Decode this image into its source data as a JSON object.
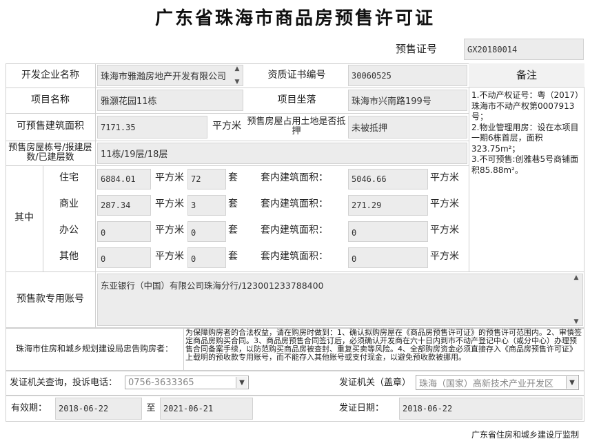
{
  "title": "广东省珠海市商品房预售许可证",
  "permit": {
    "label": "预售证号",
    "value": "GX20180014"
  },
  "developer": {
    "label": "开发企业名称",
    "value": "珠海市雅瀚房地产开发有限公司"
  },
  "cert": {
    "label": "资质证书编号",
    "value": "30060525"
  },
  "remarks_header": "备注",
  "remarks": [
    "1.不动产权证号：粤（2017）珠海市不动产权第0007913号；",
    "2.物业管理用房：设在本项目一期6栋首层，面积323.75m²；",
    "3.不可预售:创雅巷5号商铺面积85.88m²。"
  ],
  "project": {
    "label": "项目名称",
    "value": "雅灏花园11栋",
    "loc_label": "项目坐落",
    "loc_value": "珠海市兴南路199号"
  },
  "area": {
    "label": "可预售建筑面积",
    "value": "7171.35",
    "unit": "平方米",
    "land_label": "预售房屋占用土地是否抵押",
    "land_value": "未被抵押"
  },
  "building": {
    "label": "预售房屋栋号/报建层数/已建层数",
    "value": "11栋/19层/18层"
  },
  "breakdown": {
    "label": "其中",
    "unit_area": "平方米",
    "unit_count": "套",
    "inner_label": "套内建筑面积：",
    "rows": [
      {
        "type": "住宅",
        "area": "6884.01",
        "count": "72",
        "inner": "5046.66"
      },
      {
        "type": "商业",
        "area": "287.34",
        "count": "3",
        "inner": "271.29"
      },
      {
        "type": "办公",
        "area": "0",
        "count": "0",
        "inner": "0"
      },
      {
        "type": "其他",
        "area": "0",
        "count": "0",
        "inner": "0"
      }
    ]
  },
  "account": {
    "label": "预售款专用账号",
    "value": "东亚银行（中国）有限公司珠海分行/123001233788400"
  },
  "notice": {
    "label": "珠海市住房和城乡规划建设局忠告购房者：",
    "text": "为保障购房者的合法权益，请在购房时做到：1、确认拟购房屋在《商品房预售许可证》的预售许可范围内。2、审慎签定商品房购买合同。3、商品房预售合同签订后，必须确认开发商在六十日内到市不动产登记中心（或分中心）办理预售合同备案手续，以防范购买商品房被查封、重复买卖等风险。4、全部购房资金必须直接存入《商品房预售许可证》上载明的预收款专用账号，而不能存入其他账号或支付现金，以避免预收款被挪用。"
  },
  "inquiry": {
    "label": "发证机关查询，投诉电话：",
    "value": "0756-3633365"
  },
  "issuer": {
    "label": "发证机关（盖章）",
    "value": "珠海（国家）高新技术产业开发区"
  },
  "validity": {
    "label": "有效期：",
    "from": "2018-06-22",
    "to_label": "至",
    "to": "2021-06-21"
  },
  "issue_date": {
    "label": "发证日期：",
    "value": "2018-06-22"
  },
  "footer": "广东省住房和城乡建设厅监制"
}
